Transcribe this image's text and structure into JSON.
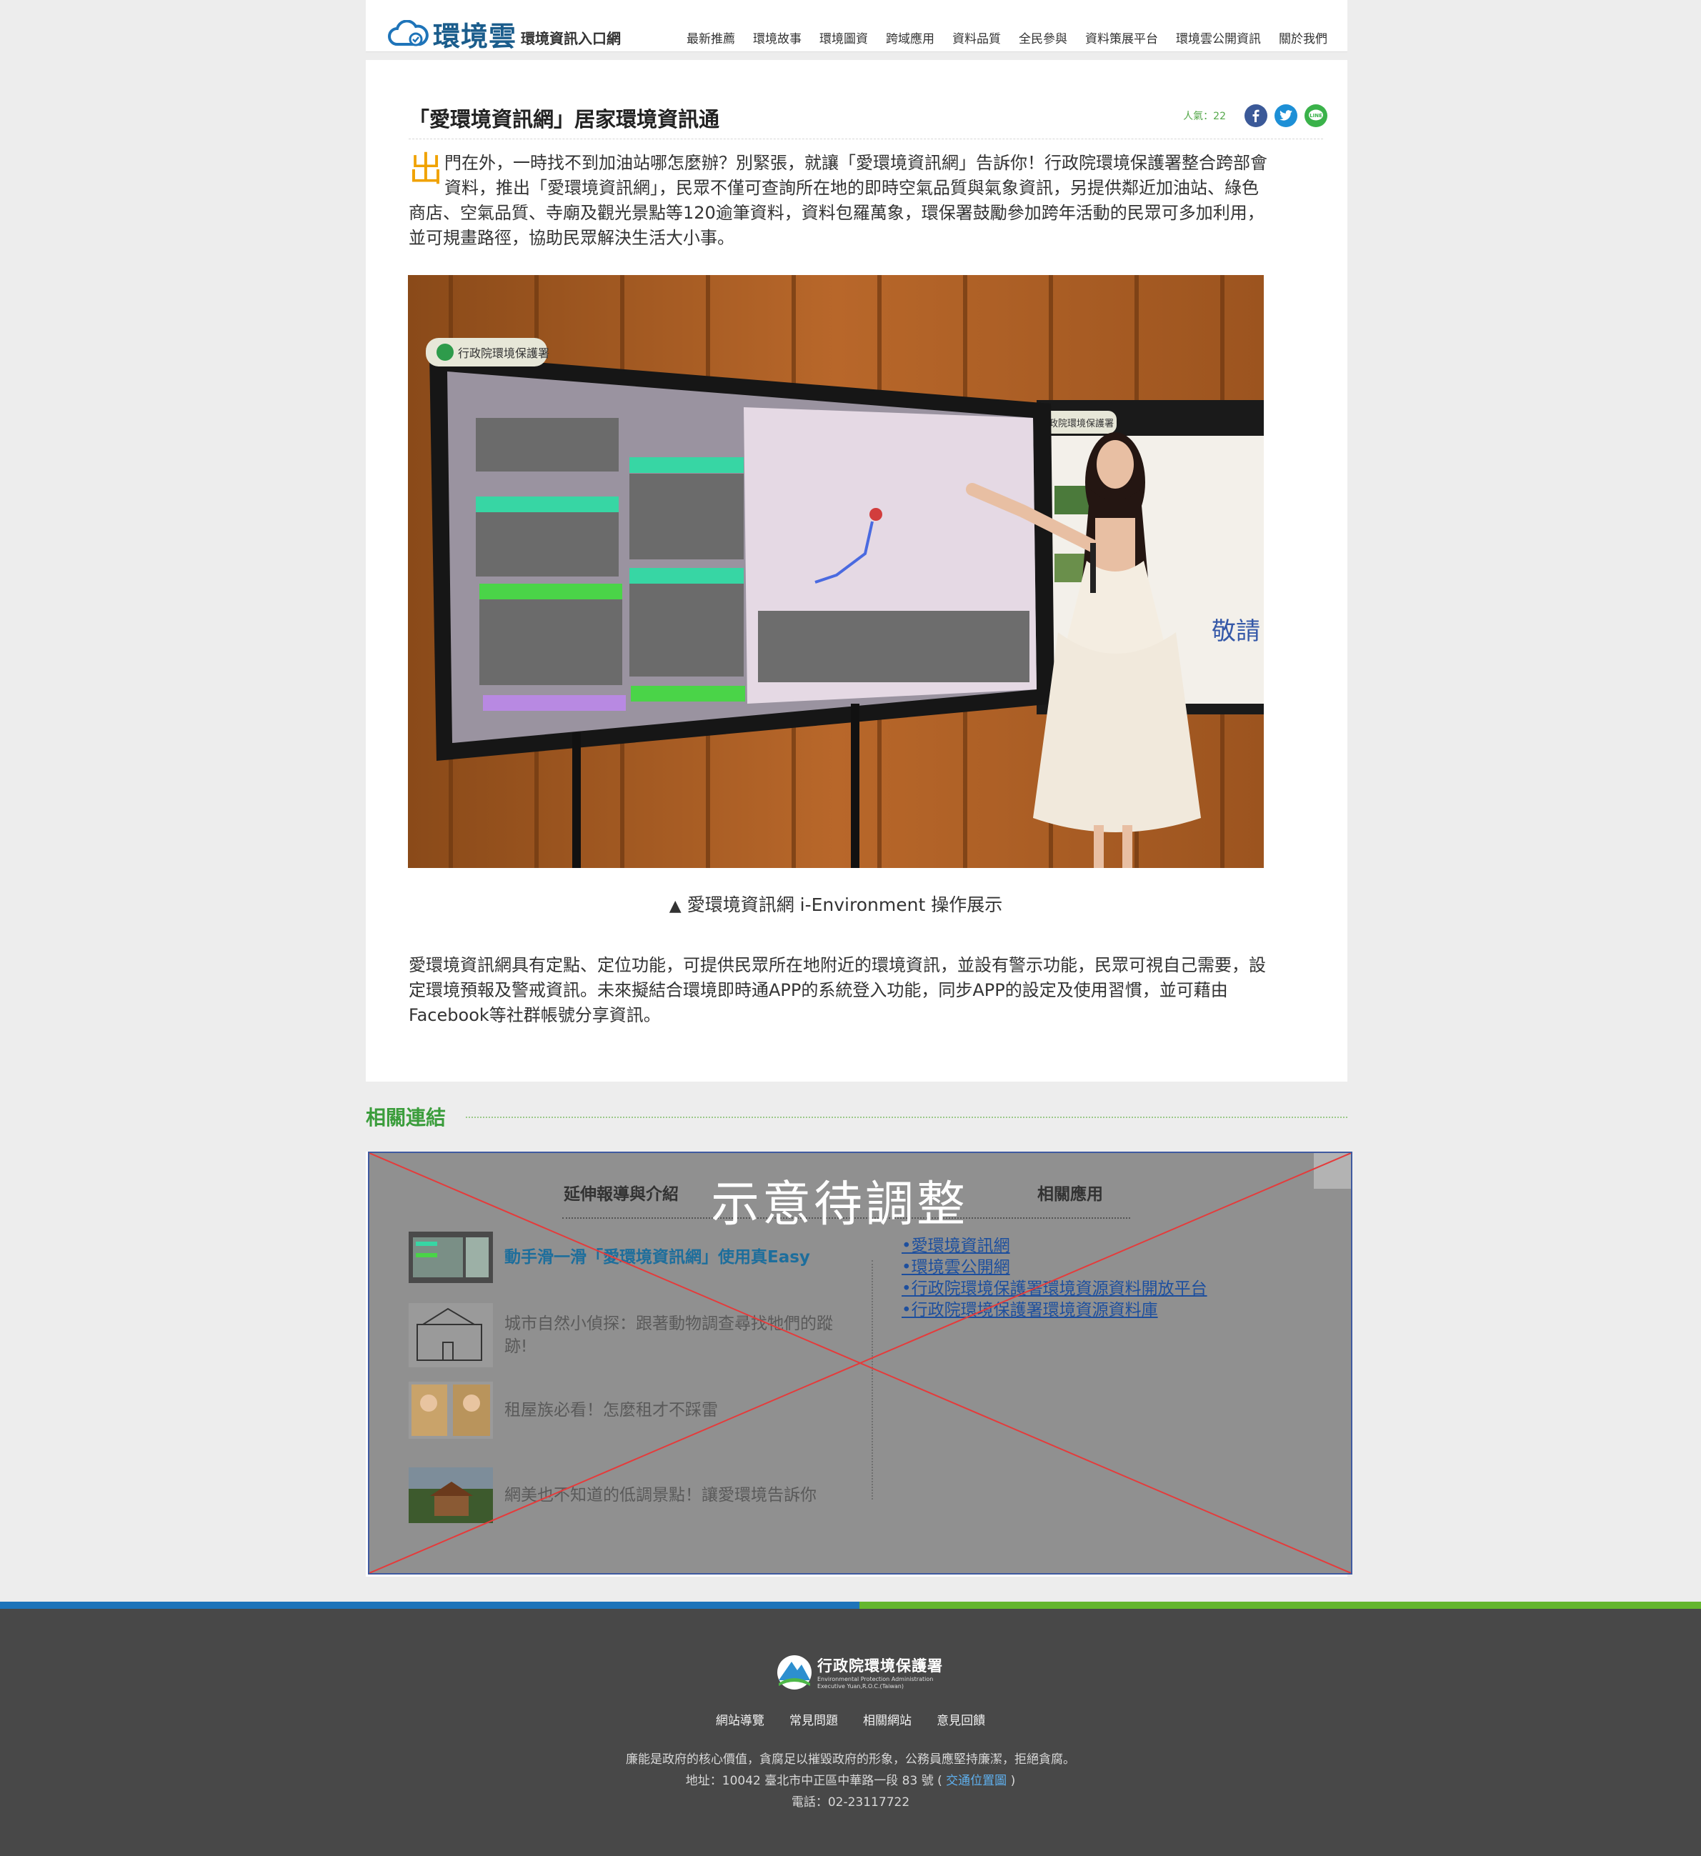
{
  "header": {
    "logo_text": "環境雲",
    "logo_sub": "環境資訊入口網",
    "nav": [
      "最新推薦",
      "環境故事",
      "環境圖資",
      "跨域應用",
      "資料品質",
      "全民參與",
      "資料策展平台",
      "環境雲公開資訊",
      "關於我們"
    ]
  },
  "article": {
    "title": "「愛環境資訊網」居家環境資訊通",
    "views_label": "人氣：",
    "views": "22",
    "share_icons": [
      "facebook-icon",
      "twitter-icon",
      "line-icon"
    ],
    "lead_dropcap": "出",
    "lead_text": "門在外，一時找不到加油站哪怎麼辦？別緊張，就讓「愛環境資訊網」告訴你！行政院環境保護署整合跨部會資料，推出「愛環境資訊網」，民眾不僅可查詢所在地的即時空氣品質與氣象資訊，另提供鄰近加油站、綠色商店、空氣品質、寺廟及觀光景點等120逾筆資料，資料包羅萬象，環保署鼓勵參加跨年活動的民眾可多加利用，並可規畫路徑，協助民眾解決生活大小事。",
    "photo_sign": "行政院環境保護署",
    "photo_side_sign": "行政院環境保護署",
    "photo_banner_text": "敬請",
    "caption_marker": "▲",
    "caption": "愛環境資訊網 i-Environment 操作展示",
    "body": "愛環境資訊網具有定點、定位功能，可提供民眾所在地附近的環境資訊，並設有警示功能，民眾可視自己需要，設定環境預報及警戒資訊。未來擬結合環境即時通APP的系統登入功能，同步APP的設定及使用習慣，並可藉由Facebook等社群帳號分享資訊。"
  },
  "related": {
    "title": "相關連結",
    "placeholder": "示意待調整",
    "left_heading": "延伸報導與介紹",
    "right_heading": "相關應用",
    "news": [
      {
        "title": "動手滑一滑「愛環境資訊網」使用真Easy"
      },
      {
        "title": "城市自然小偵探：跟著動物調查尋找牠們的蹤跡!"
      },
      {
        "title": "租屋族必看！怎麼租才不踩雷"
      },
      {
        "title": "網美也不知道的低調景點！讓愛環境告訴你"
      }
    ],
    "apps": [
      "•愛環境資訊網",
      "•環境雲公開網",
      "•行政院環境保護署環境資源資料開放平台",
      "•行政院環境保護署環境資源資料庫"
    ]
  },
  "footer": {
    "org_name": "行政院環境保護署",
    "org_en_1": "Environmental Protection Administration",
    "org_en_2": "Executive Yuan,R.O.C.(Taiwan)",
    "links": [
      "網站導覽",
      "常見問題",
      "相關網站",
      "意見回饋"
    ],
    "line1": "廉能是政府的核心價值，貪腐足以摧毀政府的形象，公務員應堅持廉潔，拒絕貪腐。",
    "address_prefix": "地址：10042 臺北市中正區中華路一段 83 號 (",
    "address_link": "交通位置圖",
    "address_suffix": ")",
    "phone": "電話：02-23117722"
  },
  "colors": {
    "brand_blue": "#1e74b9",
    "brand_green": "#64b62e",
    "related_green": "#3b9d3c",
    "dropcap": "#f0a200"
  }
}
